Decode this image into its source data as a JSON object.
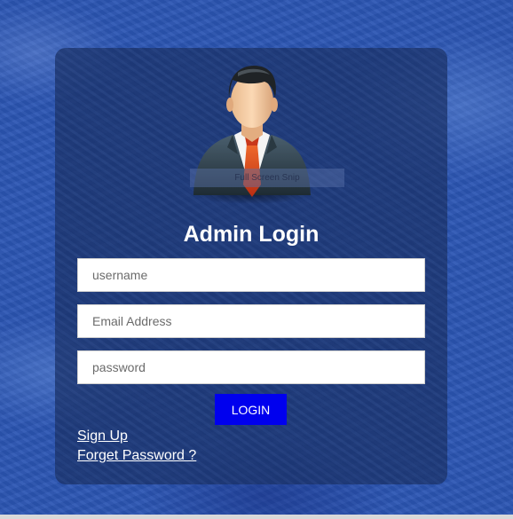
{
  "login": {
    "title": "Admin Login",
    "username_placeholder": "username",
    "email_placeholder": "Email Address",
    "password_placeholder": "password",
    "login_label": "LOGIN",
    "signup_label": "Sign Up",
    "forget_label": "Forget Password ?"
  },
  "overlay": {
    "snip_text": "Full Screen Snip"
  },
  "colors": {
    "background": "#2b55b3",
    "card": "#1c346e",
    "login_button": "#0000ee",
    "text": "#ffffff"
  },
  "icons": {
    "avatar": "admin-avatar-icon"
  }
}
